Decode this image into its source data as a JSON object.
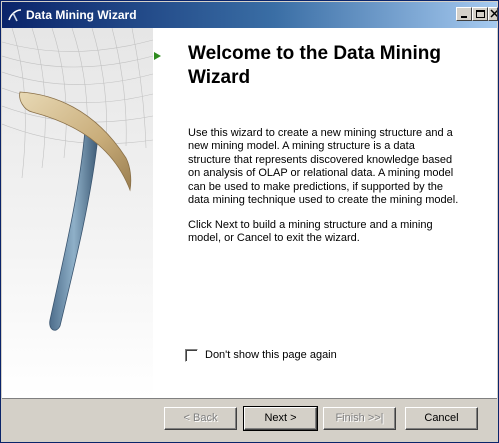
{
  "window": {
    "title": "Data Mining Wizard",
    "icon": "wizard-app-icon"
  },
  "titlebar_buttons": {
    "minimize_icon": "minimize-icon",
    "maximize_icon": "maximize-icon",
    "close_icon": "close-icon"
  },
  "page": {
    "heading": "Welcome to the Data Mining Wizard",
    "paragraph1": "Use this wizard to create a new mining structure and a new mining model. A mining structure is a data structure that represents discovered knowledge based on analysis of OLAP or relational data.  A mining model can be used to make predictions, if supported by the data mining technique used to create the mining model.",
    "paragraph2": "Click Next to build a mining structure and a mining model, or Cancel to exit the wizard.",
    "arrow_color": "#2e8b1e"
  },
  "options": {
    "dont_show_label": "Don't show this page again",
    "dont_show_checked": false
  },
  "buttons": {
    "back": "< Back",
    "next": "Next >",
    "finish": "Finish >>|",
    "cancel": "Cancel"
  }
}
